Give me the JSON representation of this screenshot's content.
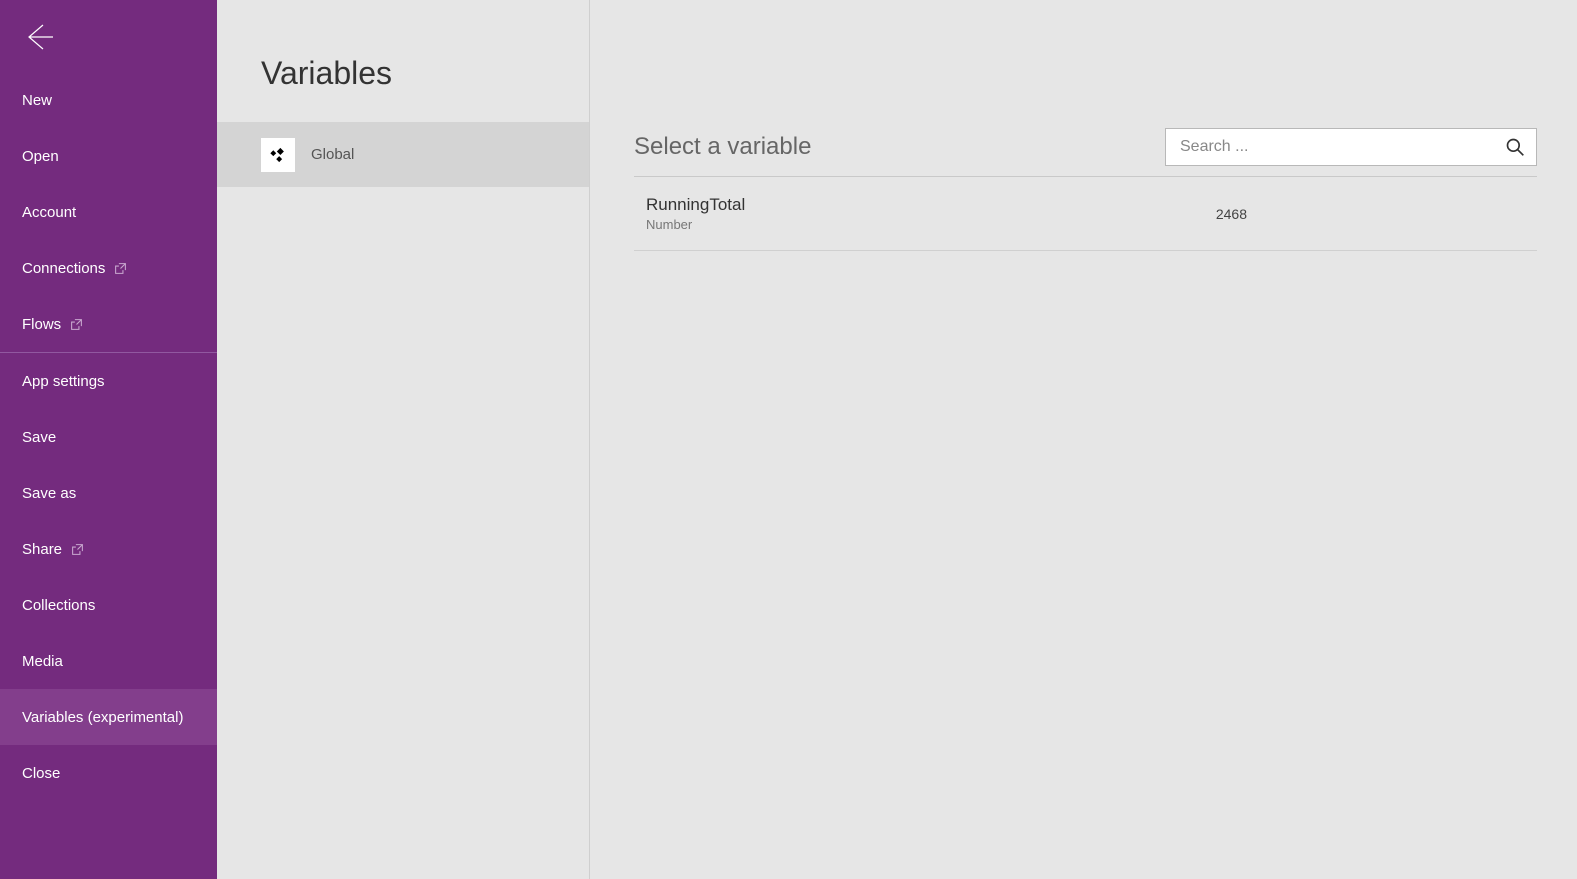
{
  "sidebar": {
    "top_items": [
      {
        "id": "new",
        "label": "New",
        "external": false,
        "active": false
      },
      {
        "id": "open",
        "label": "Open",
        "external": false,
        "active": false
      },
      {
        "id": "account",
        "label": "Account",
        "external": false,
        "active": false
      },
      {
        "id": "connections",
        "label": "Connections",
        "external": true,
        "active": false
      },
      {
        "id": "flows",
        "label": "Flows",
        "external": true,
        "active": false
      }
    ],
    "bottom_items": [
      {
        "id": "app-settings",
        "label": "App settings",
        "external": false,
        "active": false
      },
      {
        "id": "save",
        "label": "Save",
        "external": false,
        "active": false
      },
      {
        "id": "save-as",
        "label": "Save as",
        "external": false,
        "active": false
      },
      {
        "id": "share",
        "label": "Share",
        "external": true,
        "active": false
      },
      {
        "id": "collections",
        "label": "Collections",
        "external": false,
        "active": false
      },
      {
        "id": "media",
        "label": "Media",
        "external": false,
        "active": false
      },
      {
        "id": "variables-experimental",
        "label": "Variables (experimental)",
        "external": false,
        "active": true
      },
      {
        "id": "close",
        "label": "Close",
        "external": false,
        "active": false
      }
    ]
  },
  "scope": {
    "title": "Variables",
    "items": [
      {
        "id": "global",
        "label": "Global",
        "selected": true
      }
    ]
  },
  "detail": {
    "title": "Select a variable",
    "search_placeholder": "Search ...",
    "variables": [
      {
        "name": "RunningTotal",
        "type": "Number",
        "value": "2468"
      }
    ]
  }
}
